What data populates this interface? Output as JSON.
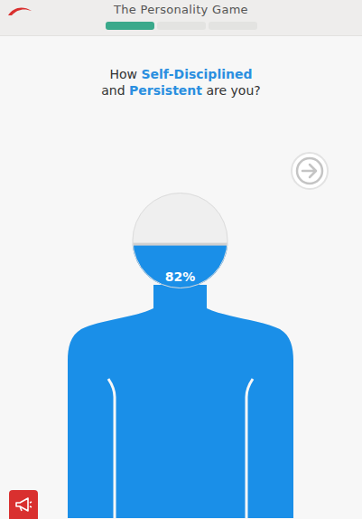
{
  "window": {
    "title": "The Personality Game"
  },
  "progress": [
    {
      "done": true
    },
    {
      "done": false
    },
    {
      "done": false
    }
  ],
  "question": {
    "lines": [
      [
        {
          "text": "How ",
          "emphasis": false
        },
        {
          "text": "Self-Disciplined",
          "emphasis": true
        }
      ],
      [
        {
          "text": "and ",
          "emphasis": false
        },
        {
          "text": "Persistent",
          "emphasis": true
        },
        {
          "text": " are you?",
          "emphasis": false
        }
      ]
    ]
  },
  "meter": {
    "reading": "82%",
    "level": 0.82
  }
}
